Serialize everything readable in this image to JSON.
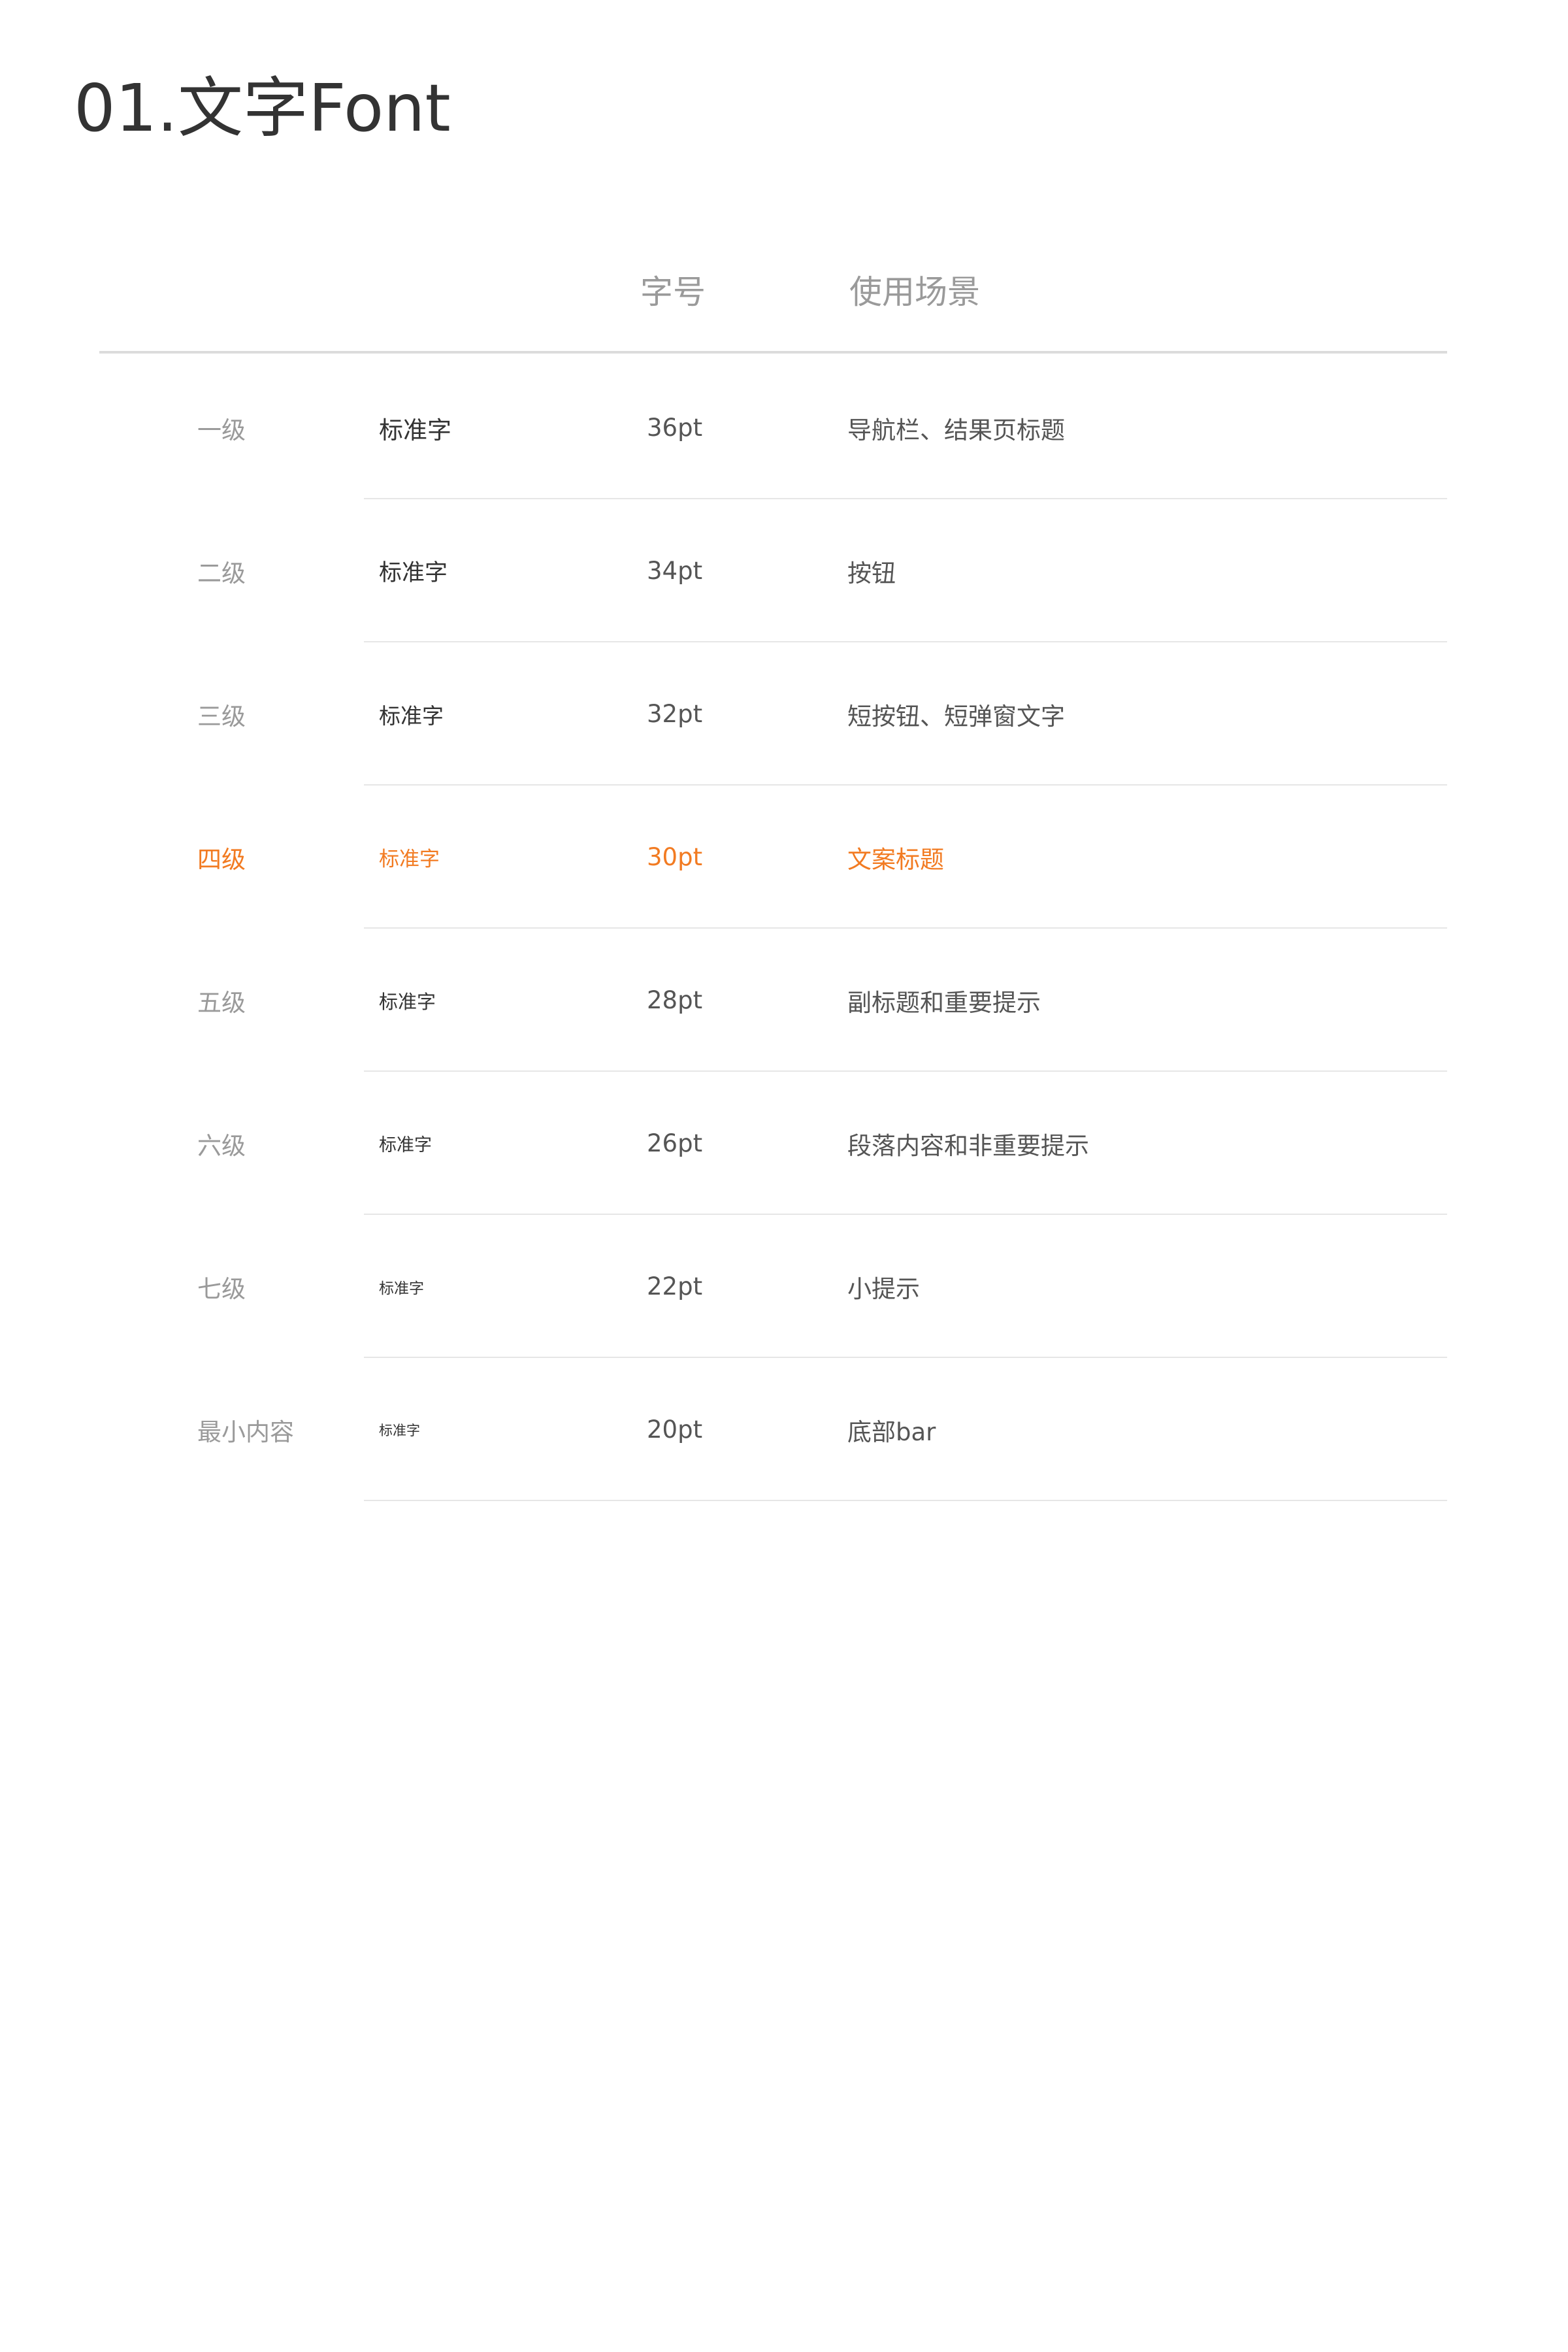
{
  "page": {
    "title": "01.文字Font"
  },
  "table": {
    "headers": {
      "size": "字号",
      "usage": "使用场景"
    },
    "highlight_color": "#f27b22",
    "rows": [
      {
        "level": "一级",
        "sample": "标准字",
        "size": "36pt",
        "usage": "导航栏、结果页标题"
      },
      {
        "level": "二级",
        "sample": "标准字",
        "size": "34pt",
        "usage": "按钮"
      },
      {
        "level": "三级",
        "sample": "标准字",
        "size": "32pt",
        "usage": "短按钮、短弹窗文字"
      },
      {
        "level": "四级",
        "sample": "标准字",
        "size": "30pt",
        "usage": "文案标题"
      },
      {
        "level": "五级",
        "sample": "标准字",
        "size": "28pt",
        "usage": "副标题和重要提示"
      },
      {
        "level": "六级",
        "sample": "标准字",
        "size": "26pt",
        "usage": "段落内容和非重要提示"
      },
      {
        "level": "七级",
        "sample": "标准字",
        "size": "22pt",
        "usage": "小提示"
      },
      {
        "level": "最小内容",
        "sample": "标准字",
        "size": "20pt",
        "usage": "底部bar"
      }
    ]
  }
}
